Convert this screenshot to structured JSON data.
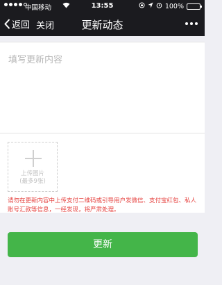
{
  "status_bar": {
    "carrier": "中国移动",
    "time": "13:55",
    "battery": "100%"
  },
  "nav": {
    "back_label": "返回",
    "close_label": "关闭",
    "title": "更新动态"
  },
  "editor": {
    "placeholder": "填写更新内容",
    "value": ""
  },
  "upload": {
    "label": "上传图片",
    "limit": "(最多9张)"
  },
  "warning": "请勿在更新内容中上传支付二维码或引导用户发微信、支付宝红包、私人账号汇款等信息，一经发现，将严肃处理。",
  "submit_label": "更新",
  "colors": {
    "topbar": "#1b1b1f",
    "accent_green": "#44b549",
    "warning_red": "#e64340",
    "page_background": "#efeff4"
  }
}
